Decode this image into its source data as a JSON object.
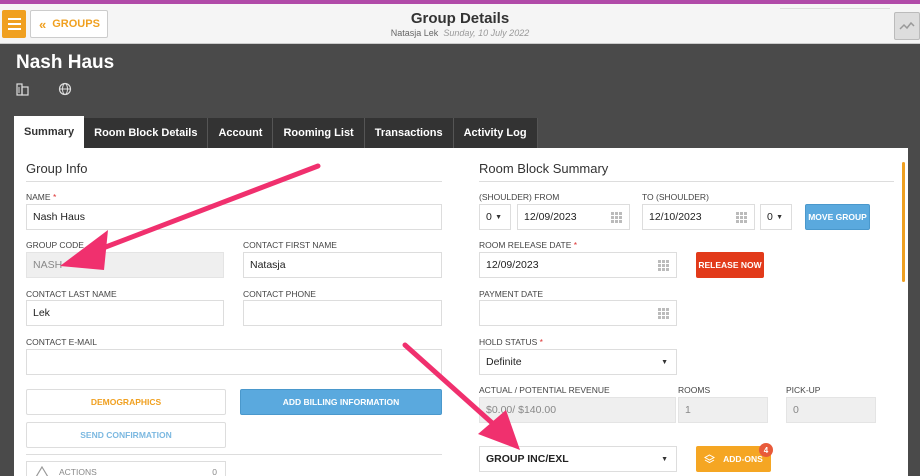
{
  "topbar": {
    "groups_label": "GROUPS",
    "title": "Group Details",
    "user": "Natasja Lek",
    "date": "Sunday, 10 July 2022"
  },
  "header": {
    "group_name": "Nash Haus",
    "icons": [
      "building-icon",
      "globe-icon"
    ]
  },
  "tabs": [
    "Summary",
    "Room Block Details",
    "Account",
    "Rooming List",
    "Transactions",
    "Activity Log"
  ],
  "group_info": {
    "title": "Group Info",
    "name_label": "NAME",
    "name_value": "Nash Haus",
    "group_code_label": "GROUP CODE",
    "group_code_value": "NASH",
    "contact_first_label": "CONTACT FIRST NAME",
    "contact_first_value": "Natasja",
    "contact_last_label": "CONTACT LAST NAME",
    "contact_last_value": "Lek",
    "contact_phone_label": "CONTACT PHONE",
    "contact_phone_value": "",
    "contact_email_label": "CONTACT E-MAIL",
    "contact_email_value": "",
    "demographics": "DEMOGRAPHICS",
    "add_billing": "ADD BILLING INFORMATION",
    "send_confirmation": "SEND CONFIRMATION",
    "actions": "ACTIONS",
    "actions_count": "0"
  },
  "room_block": {
    "title": "Room Block Summary",
    "from_label": "(SHOULDER) FROM",
    "to_label": "TO (SHOULDER)",
    "from_shoulder": "0",
    "from_date": "12/09/2023",
    "to_date": "12/10/2023",
    "to_shoulder": "0",
    "move_group": "MOVE GROUP",
    "release_label": "ROOM RELEASE DATE",
    "release_date": "12/09/2023",
    "release_now": "RELEASE NOW",
    "payment_label": "PAYMENT DATE",
    "payment_date": "",
    "hold_label": "HOLD STATUS",
    "hold_value": "Definite",
    "revenue_label": "ACTUAL / POTENTIAL REVENUE",
    "revenue_value": "$0.00/ $140.00",
    "rooms_label": "ROOMS",
    "rooms_value": "1",
    "pickup_label": "PICK-UP",
    "pickup_value": "0",
    "tax_value": "GROUP INC/EXL",
    "addons": "ADD-ONS",
    "addons_count": "4"
  },
  "colors": {
    "accent": "#f0a020",
    "arrow": "#f0306e",
    "tab_bar": "#333333",
    "release": "#e23a1a",
    "move": "#5aa9de"
  }
}
